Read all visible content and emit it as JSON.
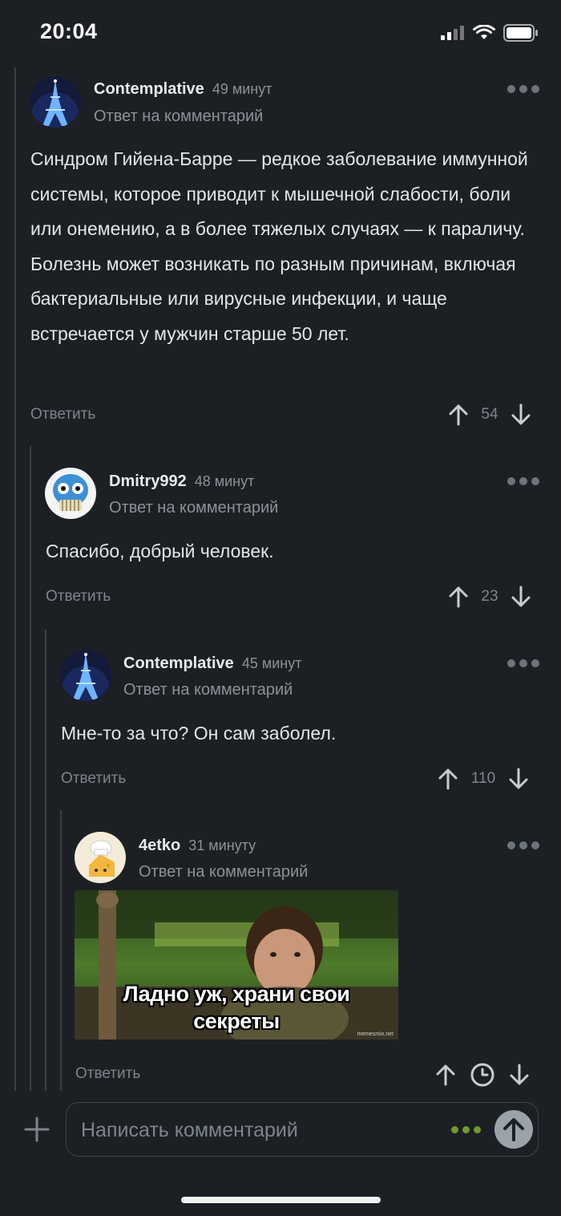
{
  "status_bar": {
    "time": "20:04"
  },
  "comments": [
    {
      "author": "Contemplative",
      "time_ago": "49 минут",
      "subtitle": "Ответ на комментарий",
      "text": "Синдром Гийена-Барре — редкое заболевание иммунной системы, которое приводит к мышечной слабости, боли или онемению, а в более тяжелых случаях — к параличу. Болезнь может возникать по разным причинам, включая бактериальные или вирусные инфекции, и чаще встречается у мужчин старше 50 лет.",
      "reply_label": "Ответить",
      "votes": "54",
      "avatar_icon": "eiffel-tower-night"
    },
    {
      "author": "Dmitry992",
      "time_ago": "48 минут",
      "subtitle": "Ответ на комментарий",
      "text": "Спасибо, добрый человек.",
      "reply_label": "Ответить",
      "votes": "23",
      "avatar_icon": "blue-skull"
    },
    {
      "author": "Contemplative",
      "time_ago": "45 минут",
      "subtitle": "Ответ на комментарий",
      "text": "Мне-то за что? Он сам заболел.",
      "reply_label": "Ответить",
      "votes": "110",
      "avatar_icon": "eiffel-tower-night"
    },
    {
      "author": "4etko",
      "time_ago": "31 минуту",
      "subtitle": "Ответ на комментарий",
      "image_caption_line1": "Ладно уж, храни свои",
      "image_caption_line2": "секреты",
      "image_watermark": "memesmix.net",
      "reply_label": "Ответить",
      "votes_icon": "clock-icon",
      "avatar_icon": "chef-cheese"
    }
  ],
  "composer": {
    "placeholder": "Написать комментарий"
  },
  "colors": {
    "background": "#1c2024",
    "accent_green": "#6f9c2a",
    "muted": "#7d858c"
  }
}
